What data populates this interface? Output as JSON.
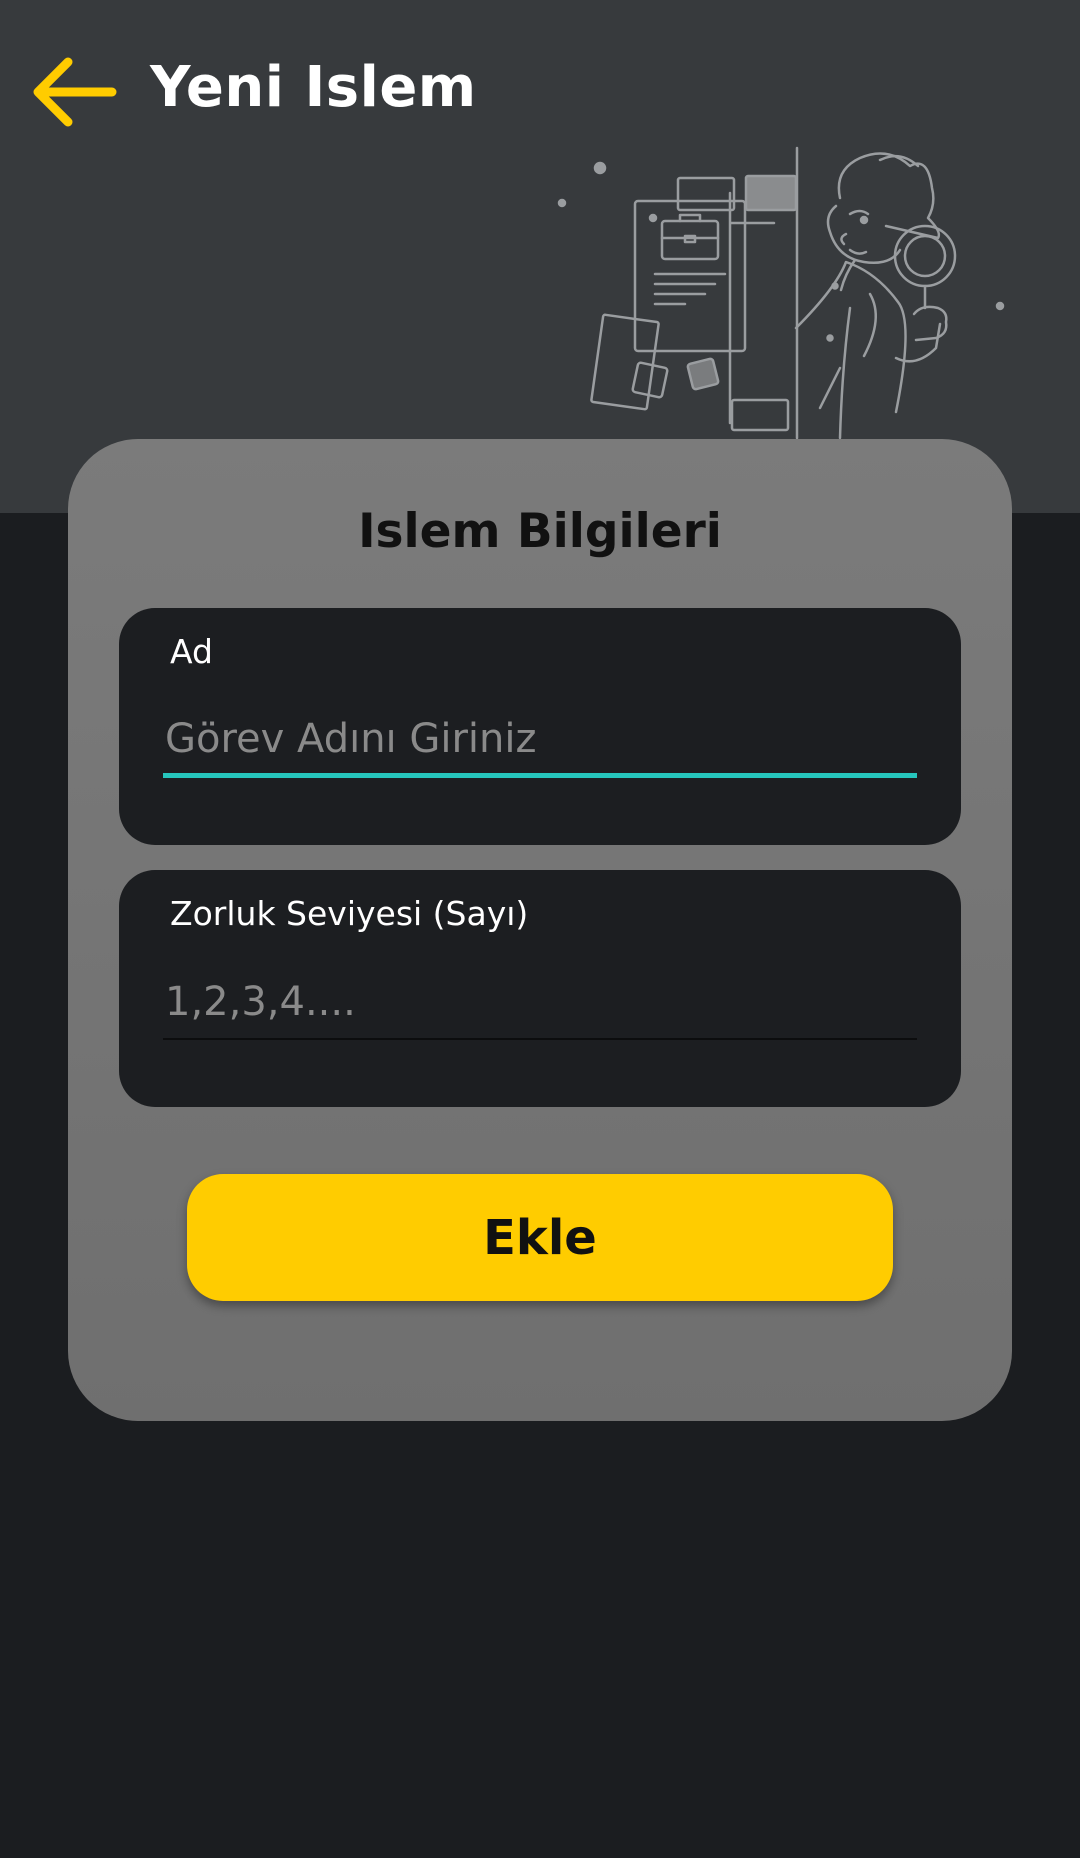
{
  "header": {
    "title": "Yeni Islem",
    "back_icon": "arrow-left-icon",
    "illustration": "detective-magnifier-illustration"
  },
  "form": {
    "title": "Islem Bilgileri",
    "fields": [
      {
        "label": "Ad",
        "value": "",
        "placeholder": "Görev Adını Giriniz",
        "focused": true
      },
      {
        "label": "Zorluk Seviyesi (Sayı)",
        "value": "",
        "placeholder": "1,2,3,4....",
        "focused": false
      }
    ],
    "submit_label": "Ekle"
  },
  "colors": {
    "background": "#1b1d20",
    "header_bg": "#373a3d",
    "card_bg": "#767676",
    "field_bg": "#1c1e21",
    "accent": "#ffcc00",
    "focus_underline": "#26c6bd",
    "status_bar": "#3b2d78"
  }
}
